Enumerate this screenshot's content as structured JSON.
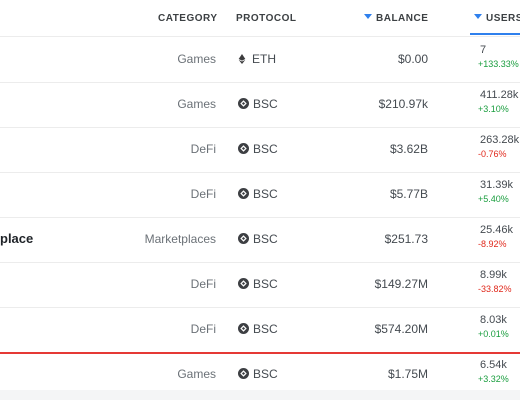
{
  "columns": {
    "category": "CATEGORY",
    "protocol": "PROTOCOL",
    "balance": "BALANCE",
    "users": "USERS"
  },
  "rows": [
    {
      "name": "",
      "category": "Games",
      "protocol": "ETH",
      "protocol_icon": "ethereum-icon",
      "balance": "$0.00",
      "users": "7",
      "delta": "+133.33%",
      "trend": "up"
    },
    {
      "name": "",
      "category": "Games",
      "protocol": "BSC",
      "protocol_icon": "bsc-icon",
      "balance": "$210.97k",
      "users": "411.28k",
      "delta": "+3.10%",
      "trend": "up"
    },
    {
      "name": "",
      "category": "DeFi",
      "protocol": "BSC",
      "protocol_icon": "bsc-icon",
      "balance": "$3.62B",
      "users": "263.28k",
      "delta": "-0.76%",
      "trend": "down"
    },
    {
      "name": "",
      "category": "DeFi",
      "protocol": "BSC",
      "protocol_icon": "bsc-icon",
      "balance": "$5.77B",
      "users": "31.39k",
      "delta": "+5.40%",
      "trend": "up"
    },
    {
      "name": "place",
      "category": "Marketplaces",
      "protocol": "BSC",
      "protocol_icon": "bsc-icon",
      "balance": "$251.73",
      "users": "25.46k",
      "delta": "-8.92%",
      "trend": "down"
    },
    {
      "name": "",
      "category": "DeFi",
      "protocol": "BSC",
      "protocol_icon": "bsc-icon",
      "balance": "$149.27M",
      "users": "8.99k",
      "delta": "-33.82%",
      "trend": "down"
    },
    {
      "name": "",
      "category": "DeFi",
      "protocol": "BSC",
      "protocol_icon": "bsc-icon",
      "balance": "$574.20M",
      "users": "8.03k",
      "delta": "+0.01%",
      "trend": "up"
    },
    {
      "name": "",
      "category": "Games",
      "protocol": "BSC",
      "protocol_icon": "bsc-icon",
      "balance": "$1.75M",
      "users": "6.54k",
      "delta": "+3.32%",
      "trend": "up"
    }
  ],
  "highlighted_row": 7,
  "colors": {
    "accent": "#2f80ed",
    "positive": "#1a9e3f",
    "negative": "#e0281b",
    "highlight_border": "#e53935"
  }
}
